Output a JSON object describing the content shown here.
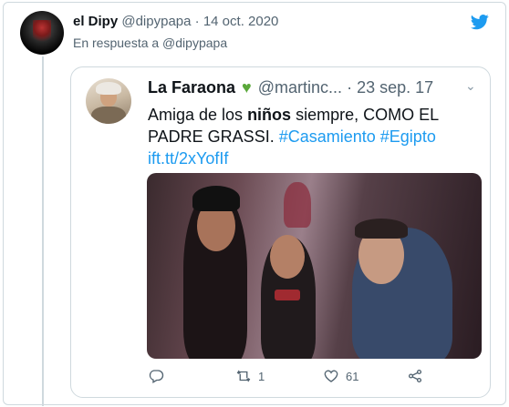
{
  "tweet": {
    "display_name": "el Dipy",
    "handle": "@dipypapa",
    "separator": "·",
    "date": "14 oct. 2020",
    "reply_to": "En respuesta a @dipypapa"
  },
  "quoted": {
    "display_name": "La Faraona",
    "handle": "@martinc...",
    "separator": "·",
    "date": "23 sep. 17",
    "text_part1": "Amiga de los ",
    "text_bold": "niños",
    "text_part2": " siempre, COMO EL PADRE GRASSI. ",
    "hashtag1": "#Casamiento",
    "hashtag2": "#Egipto",
    "link": "ift.tt/2xYofIf",
    "retweet_count": "1",
    "like_count": "61"
  },
  "icons": {
    "brand": "twitter-bird-icon",
    "badge": "green-heart-icon",
    "menu": "chevron-down-icon",
    "reply": "reply-icon",
    "retweet": "retweet-icon",
    "like": "heart-icon",
    "share": "share-icon"
  },
  "colors": {
    "link": "#1d9bf0",
    "brand": "#1d9bf0",
    "secondary_text": "#536471",
    "heart_badge": "#5aa83a"
  }
}
